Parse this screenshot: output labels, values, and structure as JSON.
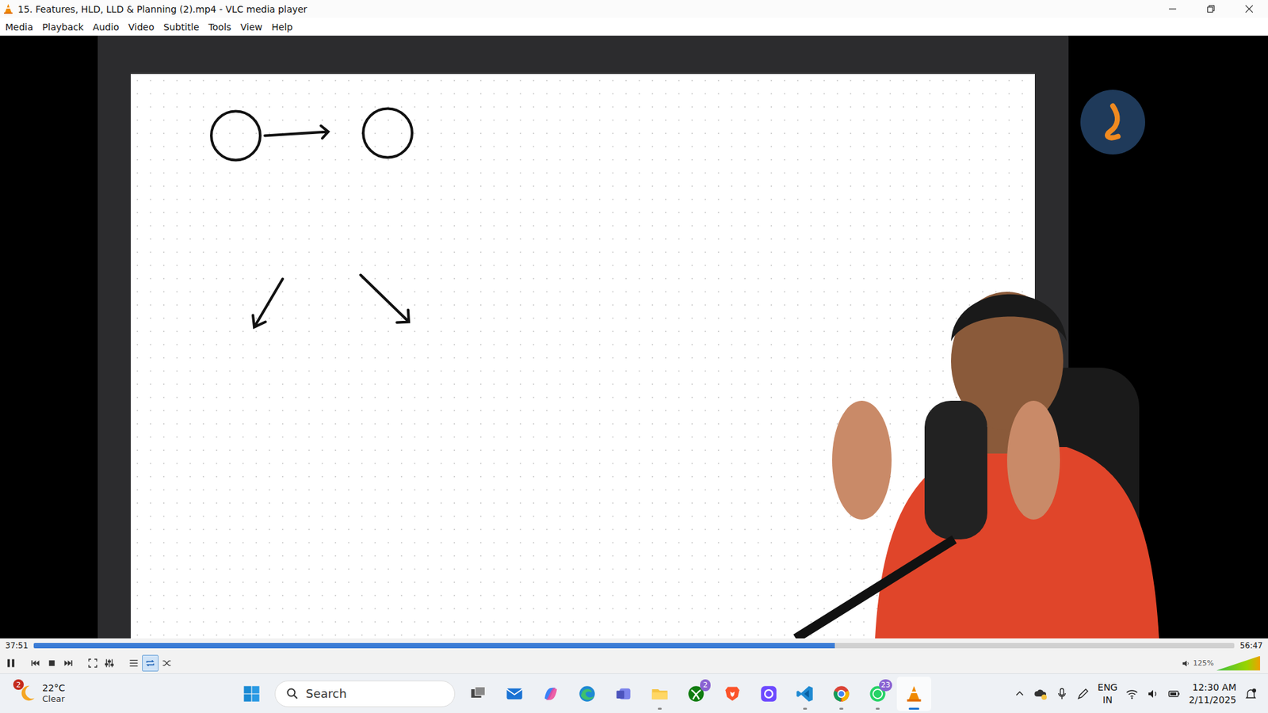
{
  "window": {
    "title": "15. Features, HLD, LLD & Planning (2).mp4 - VLC media player"
  },
  "menu": [
    "Media",
    "Playback",
    "Audio",
    "Video",
    "Subtitle",
    "Tools",
    "View",
    "Help"
  ],
  "player": {
    "elapsed": "37:51",
    "total": "56:47",
    "progress": 0.667,
    "volume": {
      "reading": "125%",
      "level": 1.0
    }
  },
  "controls": [
    {
      "kind": "pause",
      "selected": false
    },
    {
      "kind": "previous",
      "selected": false
    },
    {
      "kind": "stop",
      "selected": false
    },
    {
      "kind": "next",
      "selected": false
    },
    {
      "kind": "fullscreen",
      "selected": false
    },
    {
      "kind": "extended",
      "selected": false
    },
    {
      "kind": "playlist",
      "selected": false
    },
    {
      "kind": "loop",
      "selected": true
    },
    {
      "kind": "shuffle",
      "selected": false
    }
  ],
  "taskbar": {
    "weather": {
      "temp": "22°C",
      "condition": "Clear",
      "badge": "2"
    },
    "search": {
      "placeholder": "Search"
    },
    "apps": [
      {
        "kind": "taskview",
        "badge": "",
        "running": false,
        "active": false
      },
      {
        "kind": "mail",
        "badge": "",
        "running": false,
        "active": false
      },
      {
        "kind": "copilot",
        "badge": "",
        "running": false,
        "active": false
      },
      {
        "kind": "edge",
        "badge": "",
        "running": false,
        "active": false
      },
      {
        "kind": "teams",
        "badge": "",
        "running": false,
        "active": false
      },
      {
        "kind": "explorer",
        "badge": "",
        "running": true,
        "active": false
      },
      {
        "kind": "xbox",
        "badge": "2",
        "running": false,
        "active": false
      },
      {
        "kind": "brave",
        "badge": "",
        "running": false,
        "active": false
      },
      {
        "kind": "proton",
        "badge": "",
        "running": false,
        "active": false
      },
      {
        "kind": "vscode",
        "badge": "",
        "running": true,
        "active": false
      },
      {
        "kind": "chrome",
        "badge": "",
        "running": true,
        "active": false
      },
      {
        "kind": "whatsapp",
        "badge": "23",
        "running": true,
        "active": false
      },
      {
        "kind": "vlc",
        "badge": "",
        "running": true,
        "active": true
      }
    ],
    "tray": {
      "language": "ENG",
      "region": "IN",
      "time": "12:30 AM",
      "date": "2/11/2025"
    }
  }
}
